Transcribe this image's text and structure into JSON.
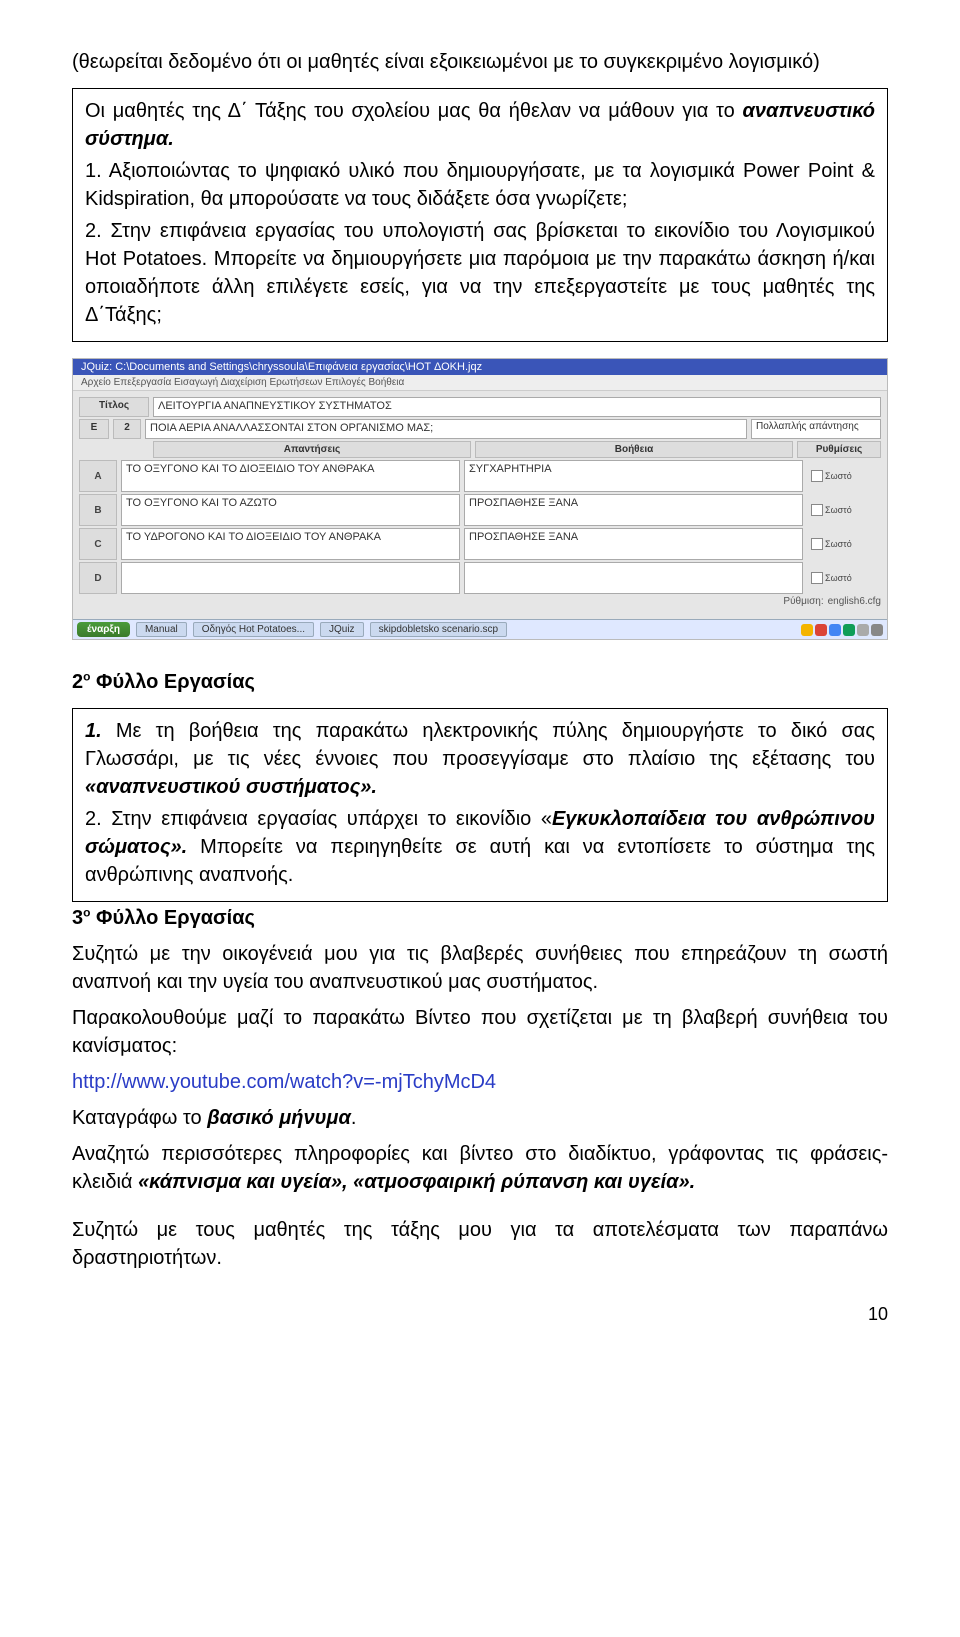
{
  "intro": {
    "note": "(θεωρείται δεδομένο ότι οι μαθητές είναι εξοικειωμένοι με το συγκεκριμένο λογισμικό)"
  },
  "box1": {
    "line1a": "Οι μαθητές της Δ΄ Τάξης του σχολείου μας θα ήθελαν να μάθουν για το ",
    "line1b": "αναπνευστικό σύστημα.",
    "item1": "1. Αξιοποιώντας το ψηφιακό υλικό που δημιουργήσατε, με τα λογισμικά Power Point & Kidspiration, θα μπορούσατε να τους διδάξετε όσα γνωρίζετε;",
    "item2": "2. Στην επιφάνεια εργασίας του υπολογιστή σας βρίσκεται το εικονίδιο του Λογισμικού Hot Potatoes. Μπορείτε να δημιουργήσετε μια παρόμοια με την παρακάτω άσκηση ή/και οποιαδήποτε άλλη επιλέγετε εσείς, για να την επεξεργαστείτε με τους μαθητές της Δ΄Τάξης;"
  },
  "screenshot": {
    "title": "JQuiz: C:\\Documents and Settings\\chryssoula\\Επιφάνεια εργασίας\\HOT ΔΟΚΗ.jqz",
    "menu": "Αρχείο   Επεξεργασία   Εισαγωγή   Διαχείριση Ερωτήσεων   Επιλογές   Βοήθεια",
    "lbl_title": "Τίτλος",
    "fld_title": "ΛΕΙΤΟΥΡΓΙΑ ΑΝΑΠΝΕΥΣΤΙΚΟΥ ΣΥΣΤΗΜΑΤΟΣ",
    "lbl_e": "Ε",
    "num": "2",
    "fld_q": "ΠΟΙΑ ΑΕΡΙΑ ΑΝΑΛΛΑΣΣΟΝΤΑΙ ΣΤΟΝ ΟΡΓΑΝΙΣΜΟ ΜΑΣ;",
    "dd": "Πολλαπλής απάντησης",
    "hdr_ans": "Απαντήσεις",
    "hdr_help": "Βοήθεια",
    "hdr_set": "Ρυθμίσεις",
    "rows": [
      {
        "k": "A",
        "ans": "ΤΟ ΟΞΥΓΟΝΟ ΚΑΙ ΤΟ ΔΙΟΞΕΙΔΙΟ ΤΟΥ ΑΝΘΡΑΚΑ",
        "help": "ΣΥΓΧΑΡΗΤΗΡΙΑ"
      },
      {
        "k": "B",
        "ans": "ΤΟ ΟΞΥΓΟΝΟ ΚΑΙ ΤΟ ΑΖΩΤΟ",
        "help": "ΠΡΟΣΠΑΘΗΣΕ ΞΑΝΑ"
      },
      {
        "k": "C",
        "ans": "ΤΟ ΥΔΡΟΓΟΝΟ ΚΑΙ ΤΟ ΔΙΟΞΕΙΔΙΟ ΤΟΥ ΑΝΘΡΑΚΑ",
        "help": "ΠΡΟΣΠΑΘΗΣΕ ΞΑΝΑ"
      },
      {
        "k": "D",
        "ans": "",
        "help": ""
      }
    ],
    "correct": "Σωστό",
    "f_lbl": "Ρύθμιση:",
    "f_val": "english6.cfg",
    "tb_start": "έναρξη",
    "tb_items": [
      "Manual",
      "Οδηγός Hot Potatoes...",
      "JQuiz",
      "skipdobletsko scenario.scp"
    ]
  },
  "sec2": {
    "heading_pre": "2",
    "heading_sup": "ο",
    "heading_txt": " Φύλλο Εργασίας"
  },
  "box2": {
    "i1a": "1.",
    "i1b": " Με τη βοήθεια της παρακάτω ηλεκτρονικής πύλης δημιουργήστε το δικό σας Γλωσσάρι, με τις νέες έννοιες που προσεγγίσαμε στο πλαίσιο της εξέτασης του ",
    "i1c": "«αναπνευστικού συστήματος».",
    "i2a": "2. Στην επιφάνεια εργασίας υπάρχει το εικονίδιο «",
    "i2b": "Εγκυκλοπαίδεια του ανθρώπινου σώματος».",
    "i2c": " Μπορείτε να περιηγηθείτε σε αυτή και να εντοπίσετε το σύστημα της ανθρώπινης αναπνοής."
  },
  "sec3": {
    "heading_pre": "3",
    "heading_sup": "ο",
    "heading_txt": " Φύλλο Εργασίας",
    "p1": "Συζητώ με την οικογένειά μου για τις βλαβερές συνήθειες που επηρεάζουν τη σωστή αναπνοή και την υγεία του αναπνευστικού μας συστήματος.",
    "p2": "Παρακολουθούμε μαζί το παρακάτω Βίντεο που σχετίζεται με τη βλαβερή συνήθεια του κανίσματος:",
    "link": "http://www.youtube.com/watch?v=-mjTchyMcD4",
    "p3a": "Καταγράφω το ",
    "p3b": "βασικό μήνυμα",
    "p3c": ".",
    "p4a": "Αναζητώ περισσότερες πληροφορίες και βίντεο στο διαδίκτυο, γράφοντας τις φράσεις- κλειδιά ",
    "p4b": "«κάπνισμα και υγεία», «ατμοσφαιρική ρύπανση και υγεία».",
    "p5": "Συζητώ με τους μαθητές της τάξης μου για τα αποτελέσματα των παραπάνω δραστηριοτήτων."
  },
  "pagenum": "10"
}
